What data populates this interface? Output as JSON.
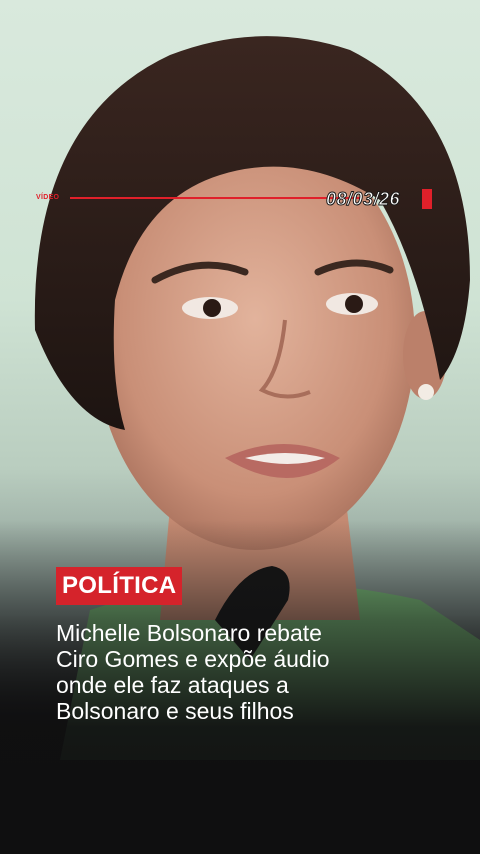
{
  "overlay": {
    "tag": "VÍDEO",
    "date": "08/03/26"
  },
  "category": "POLÍTICA",
  "headline": [
    "Michelle Bolsonaro rebate",
    "Ciro Gomes e expõe áudio",
    "onde ele faz ataques a",
    "Bolsonaro e seus filhos"
  ],
  "colors": {
    "accent": "#d5232b",
    "background": "#0f0f10",
    "text": "#ffffff"
  }
}
